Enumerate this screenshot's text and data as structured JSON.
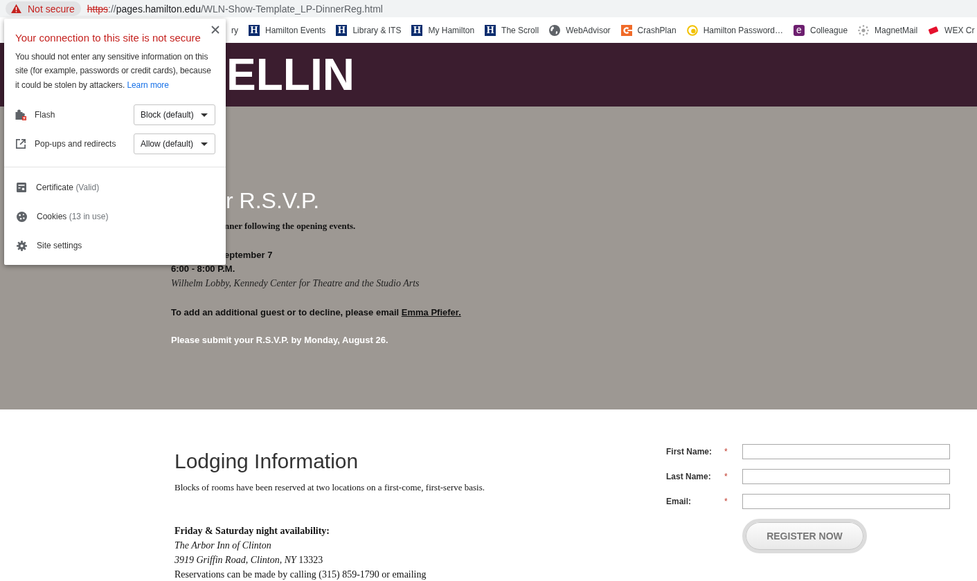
{
  "address_bar": {
    "secure": false,
    "security_label": "Not secure",
    "url": {
      "scheme": "https",
      "separator": "://",
      "host": "pages.hamilton.edu",
      "path": "/WLN-Show-Template_LP-DinnerReg.html"
    }
  },
  "bookmarks": [
    {
      "label": "ry"
    },
    {
      "label": "Hamilton Events",
      "kind": "square-letter",
      "letter": "H"
    },
    {
      "label": "Library & ITS",
      "kind": "square-letter",
      "letter": "H"
    },
    {
      "label": "My Hamilton",
      "kind": "square-letter",
      "letter": "H"
    },
    {
      "label": "The Scroll",
      "kind": "square-letter",
      "letter": "H"
    },
    {
      "label": "WebAdvisor",
      "kind": "globe"
    },
    {
      "label": "CrashPlan",
      "kind": "c-tile"
    },
    {
      "label": "Hamilton Password…",
      "kind": "swirl"
    },
    {
      "label": "Colleague",
      "kind": "rounded-letter",
      "letter": "e"
    },
    {
      "label": "MagnetMail",
      "kind": "splat"
    },
    {
      "label": "WEX Cr",
      "kind": "tag"
    }
  ],
  "site_header": {
    "logo_text": "ELLIN"
  },
  "hero": {
    "title": "r R.S.V.P.",
    "intro": "nner following the opening events.",
    "date": "eptember 7",
    "time": "6:00 - 8:00 P.M.",
    "venue": "Wilhelm Lobby, Kennedy Center for Theatre and the Studio Arts",
    "contact": {
      "text": "To add an additional guest or to decline, please email",
      "link": "Emma Pfiefer."
    },
    "deadline": "Please submit your R.S.V.P. by Monday, August 26."
  },
  "lodging": {
    "title": "Lodging Information",
    "intro": "Blocks of rooms have been reserved at two locations on a first-come, first-serve basis.",
    "subheading": "Friday & Saturday night availability:",
    "hotel": "The Arbor Inn of Clinton",
    "address": "*3919 Griffin Road, Clinton, NY* 13323",
    "reservations": "Reservations can be made by calling (315) 859-1790 or emailing"
  },
  "form": {
    "fields": [
      {
        "label": "First Name:",
        "required_mark": "*"
      },
      {
        "label": "Last Name:",
        "required_mark": "*"
      },
      {
        "label": "Email:",
        "required_mark": "*"
      }
    ],
    "submit": "REGISTER NOW"
  },
  "site_info_popup": {
    "title": "Your connection to this site is not secure",
    "message": "You should not enter any sensitive information on this site (for example, passwords or credit cards), because it could be stolen by attackers.",
    "learn_more": "Learn more",
    "permissions": [
      {
        "kind": "plugin",
        "label": "Flash",
        "value": "Block (default)"
      },
      {
        "kind": "popups",
        "label": "Pop-ups and redirects",
        "value": "Allow (default)"
      }
    ],
    "items": [
      {
        "kind": "certificate",
        "label": "Certificate",
        "detail": "(Valid)"
      },
      {
        "kind": "cookies",
        "label": "Cookies",
        "detail": "(13 in use)"
      },
      {
        "kind": "settings",
        "label": "Site settings"
      }
    ]
  }
}
